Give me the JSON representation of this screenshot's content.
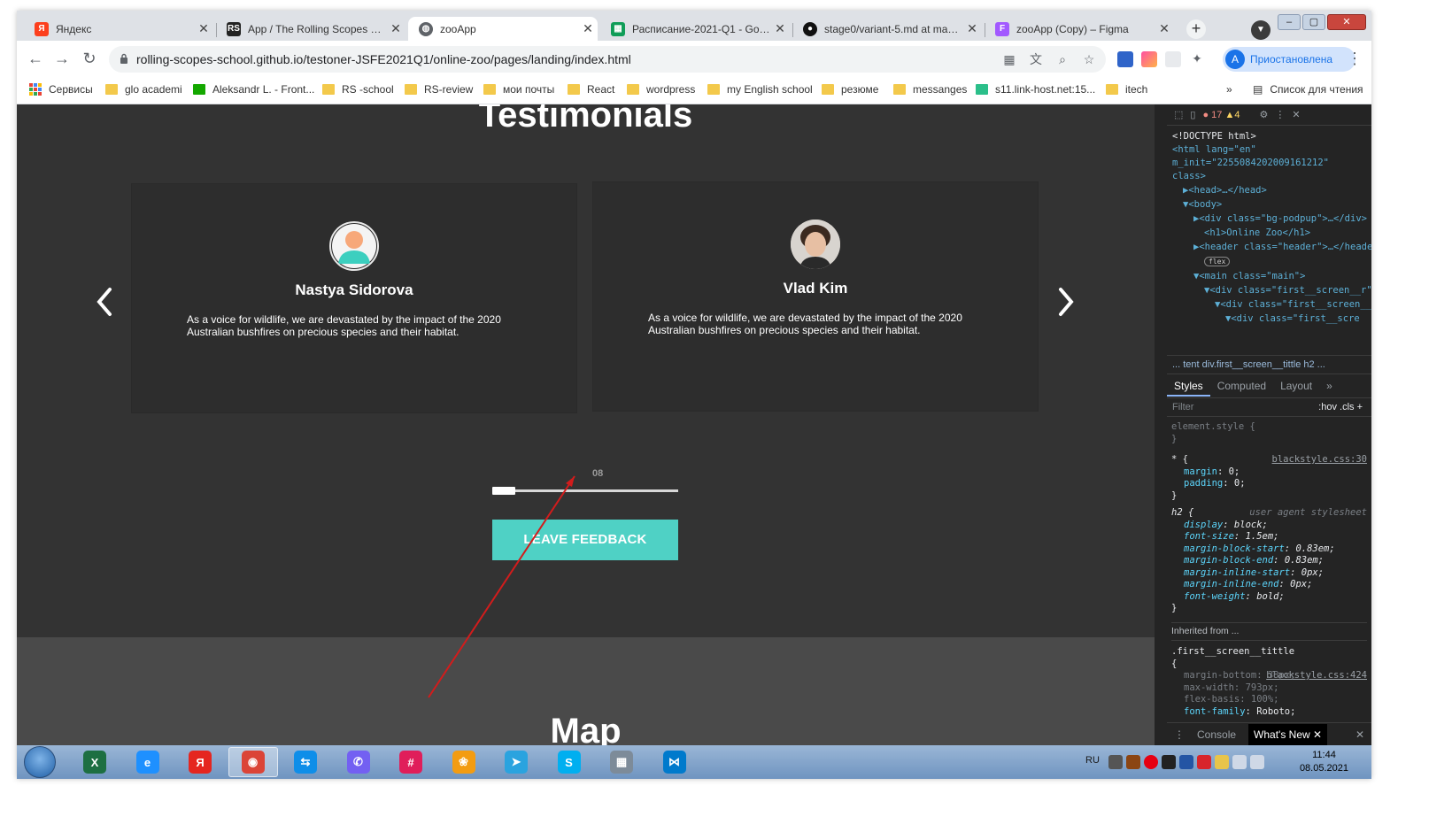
{
  "browser": {
    "tabs": [
      {
        "label": "Яндекс",
        "favicon_color": "#fc3f1d",
        "favicon_text": "Я"
      },
      {
        "label": "App / The Rolling Scopes School",
        "favicon_color": "#222222",
        "favicon_text": "RS"
      },
      {
        "label": "zooApp",
        "favicon_color": "#5f6368",
        "favicon_text": "◍"
      },
      {
        "label": "Расписание-2021-Q1 - Google",
        "favicon_color": "#0f9d58",
        "favicon_text": "▦"
      },
      {
        "label": "stage0/variant-5.md at master",
        "favicon_color": "#111111",
        "favicon_text": "●"
      },
      {
        "label": "zooApp (Copy) – Figma",
        "favicon_color": "#a259ff",
        "favicon_text": "F"
      }
    ],
    "active_tab_index": 2,
    "url": "rolling-scopes-school.github.io/testoner-JSFE2021Q1/online-zoo/pages/landing/index.html",
    "profile_status": "Приостановлена",
    "profile_initial": "A",
    "bookmarks": [
      {
        "label": "Сервисы",
        "type": "apps"
      },
      {
        "label": "glo academi",
        "type": "folder"
      },
      {
        "label": "Aleksandr L. - Front...",
        "type": "upwork"
      },
      {
        "label": "RS -school",
        "type": "folder"
      },
      {
        "label": "RS-review",
        "type": "folder"
      },
      {
        "label": "мои почты",
        "type": "folder"
      },
      {
        "label": "React",
        "type": "folder"
      },
      {
        "label": "wordpress",
        "type": "folder"
      },
      {
        "label": "my English school",
        "type": "folder"
      },
      {
        "label": "резюме",
        "type": "folder"
      },
      {
        "label": "messanges",
        "type": "folder"
      },
      {
        "label": "s11.link-host.net:15...",
        "type": "site"
      },
      {
        "label": "itech",
        "type": "folder"
      }
    ],
    "more_bookmarks": "»",
    "reading_list": "Список для чтения"
  },
  "page": {
    "section_title": "Testimonials",
    "testimonials": [
      {
        "name": "Nastya Sidorova",
        "text": "As a voice for wildlife, we are devastated by the impact of the 2020 Australian bushfires on precious species and their habitat."
      },
      {
        "name": "Vlad Kim",
        "text": "As a voice for wildlife, we are devastated by the impact of the 2020 Australian bushfires on precious species and their habitat."
      }
    ],
    "slider_value_label": "08",
    "slider_progress": 0.12,
    "feedback_button": "LEAVE FEEDBACK",
    "next_section_title": "Map",
    "accent_color": "#4fd1c5"
  },
  "devtools": {
    "errors": "17",
    "warnings": "4",
    "dom_lines": [
      "<!DOCTYPE html>",
      "<html lang=\"en\" m_init=\"2255084202009161212\" class>",
      "▶<head>…</head>",
      "▼<body>",
      "▶<div class=\"bg-podpup\">…</div>",
      "<h1>Online Zoo</h1>",
      "▶<header class=\"header\">…</header>",
      "▼<main class=\"main\">",
      "▼<div class=\"first__screen__r\">",
      "▼<div class=\"first__screen__content\">",
      "▼<div class=\"first__scre"
    ],
    "flex_badge": "flex",
    "breadcrumbs": "... tent   div.first__screen__tittle   h2   ...",
    "tabs": [
      "Styles",
      "Computed",
      "Layout"
    ],
    "tabs_more": "»",
    "filter_placeholder": "Filter",
    "filter_tools": ":hov  .cls  +",
    "styles": {
      "element_style": "element.style {",
      "star_selector": "* {",
      "star_source": "blackstyle.css:30",
      "star_props": [
        [
          "margin",
          "0"
        ],
        [
          "padding",
          "0"
        ]
      ],
      "h2_selector": "h2 {",
      "h2_source": "user agent stylesheet",
      "h2_props": [
        [
          "display",
          "block"
        ],
        [
          "font-size",
          "1.5em"
        ],
        [
          "margin-block-start",
          "0.83em"
        ],
        [
          "margin-block-end",
          "0.83em"
        ],
        [
          "margin-inline-start",
          "0px"
        ],
        [
          "margin-inline-end",
          "0px"
        ],
        [
          "font-weight",
          "bold"
        ]
      ],
      "inherited_from": "Inherited from ...",
      "inh_selector": ".first__screen__tittle {",
      "inh_source": "blackstyle.css:424",
      "inh_props": [
        [
          "margin-bottom",
          "38px"
        ],
        [
          "max-width",
          "793px"
        ],
        [
          "flex-basis",
          "100%"
        ],
        [
          "font-family",
          "Roboto"
        ]
      ]
    },
    "console_tabs": [
      "Console",
      "What's New"
    ]
  },
  "taskbar": {
    "apps": [
      {
        "name": "excel",
        "color": "#1d6f42",
        "glyph": "X"
      },
      {
        "name": "internet-explorer",
        "color": "#1e90ff",
        "glyph": "e"
      },
      {
        "name": "yandex-browser",
        "color": "#e52620",
        "glyph": "Я"
      },
      {
        "name": "chrome",
        "color": "#db4437",
        "glyph": "◉"
      },
      {
        "name": "teamviewer",
        "color": "#0e8ee9",
        "glyph": "⇆"
      },
      {
        "name": "viber",
        "color": "#7360f2",
        "glyph": "✆"
      },
      {
        "name": "slack",
        "color": "#e01e5a",
        "glyph": "#"
      },
      {
        "name": "fish-app",
        "color": "#f39c12",
        "glyph": "❀"
      },
      {
        "name": "telegram",
        "color": "#2aa3df",
        "glyph": "➤"
      },
      {
        "name": "skype",
        "color": "#00aff0",
        "glyph": "S"
      },
      {
        "name": "calculator",
        "color": "#7d8b99",
        "glyph": "▦"
      },
      {
        "name": "vscode",
        "color": "#007acc",
        "glyph": "⋈"
      }
    ],
    "active_app": "chrome",
    "language": "RU",
    "time": "11:44",
    "date": "08.05.2021"
  }
}
